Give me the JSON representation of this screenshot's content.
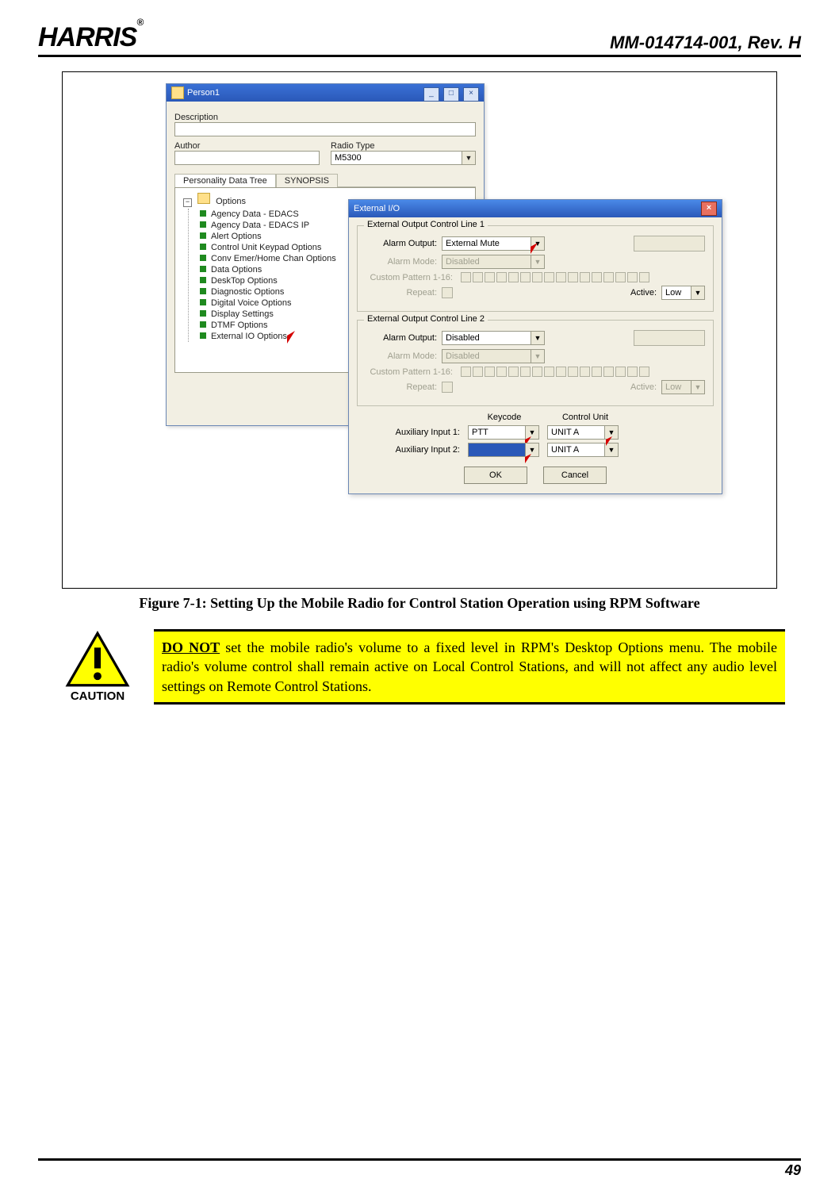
{
  "header": {
    "logo_text": "HARRIS",
    "logo_reg": "®",
    "doc_id": "MM-014714-001, Rev. H"
  },
  "figure": {
    "caption": "Figure 7-1:  Setting Up the Mobile Radio for Control Station Operation using RPM Software"
  },
  "person_win": {
    "title": "Person1",
    "desc_label": "Description",
    "desc_value": "",
    "author_label": "Author",
    "author_value": "",
    "radio_type_label": "Radio Type",
    "radio_type_value": "M5300",
    "tab_tree": "Personality Data Tree",
    "tab_synopsis": "SYNOPSIS",
    "tree_root": "Options",
    "tree_items": [
      "Agency Data - EDACS",
      "Agency Data - EDACS IP",
      "Alert Options",
      "Control Unit Keypad Options",
      "Conv Emer/Home Chan Options",
      "Data Options",
      "DeskTop Options",
      "Diagnostic Options",
      "Digital Voice Options",
      "Display Settings",
      "DTMF Options",
      "External IO Options"
    ]
  },
  "ext_io": {
    "title": "External I/O",
    "group1": "External Output Control Line 1",
    "group2": "External Output Control Line 2",
    "alarm_output": "Alarm Output:",
    "alarm_mode": "Alarm Mode:",
    "custom_pattern": "Custom Pattern 1-16:",
    "repeat": "Repeat:",
    "active": "Active:",
    "line1_output": "External Mute",
    "line1_mode": "Disabled",
    "line1_active": "Low",
    "line2_output": "Disabled",
    "line2_mode": "Disabled",
    "line2_active": "Low",
    "keycode": "Keycode",
    "control_unit": "Control Unit",
    "aux1_label": "Auxiliary Input 1:",
    "aux1_key": "PTT",
    "aux1_unit": "UNIT A",
    "aux2_label": "Auxiliary Input 2:",
    "aux2_key": "",
    "aux2_unit": "UNIT A",
    "ok": "OK",
    "cancel": "Cancel"
  },
  "caution": {
    "label": "CAUTION",
    "lead": "DO NOT",
    "rest": " set the mobile radio's volume to a fixed level in RPM's Desktop Options menu.  The mobile radio's volume control shall remain active on Local Control Stations, and will not affect any audio level settings on Remote Control Stations."
  },
  "footer": {
    "page": "49"
  }
}
